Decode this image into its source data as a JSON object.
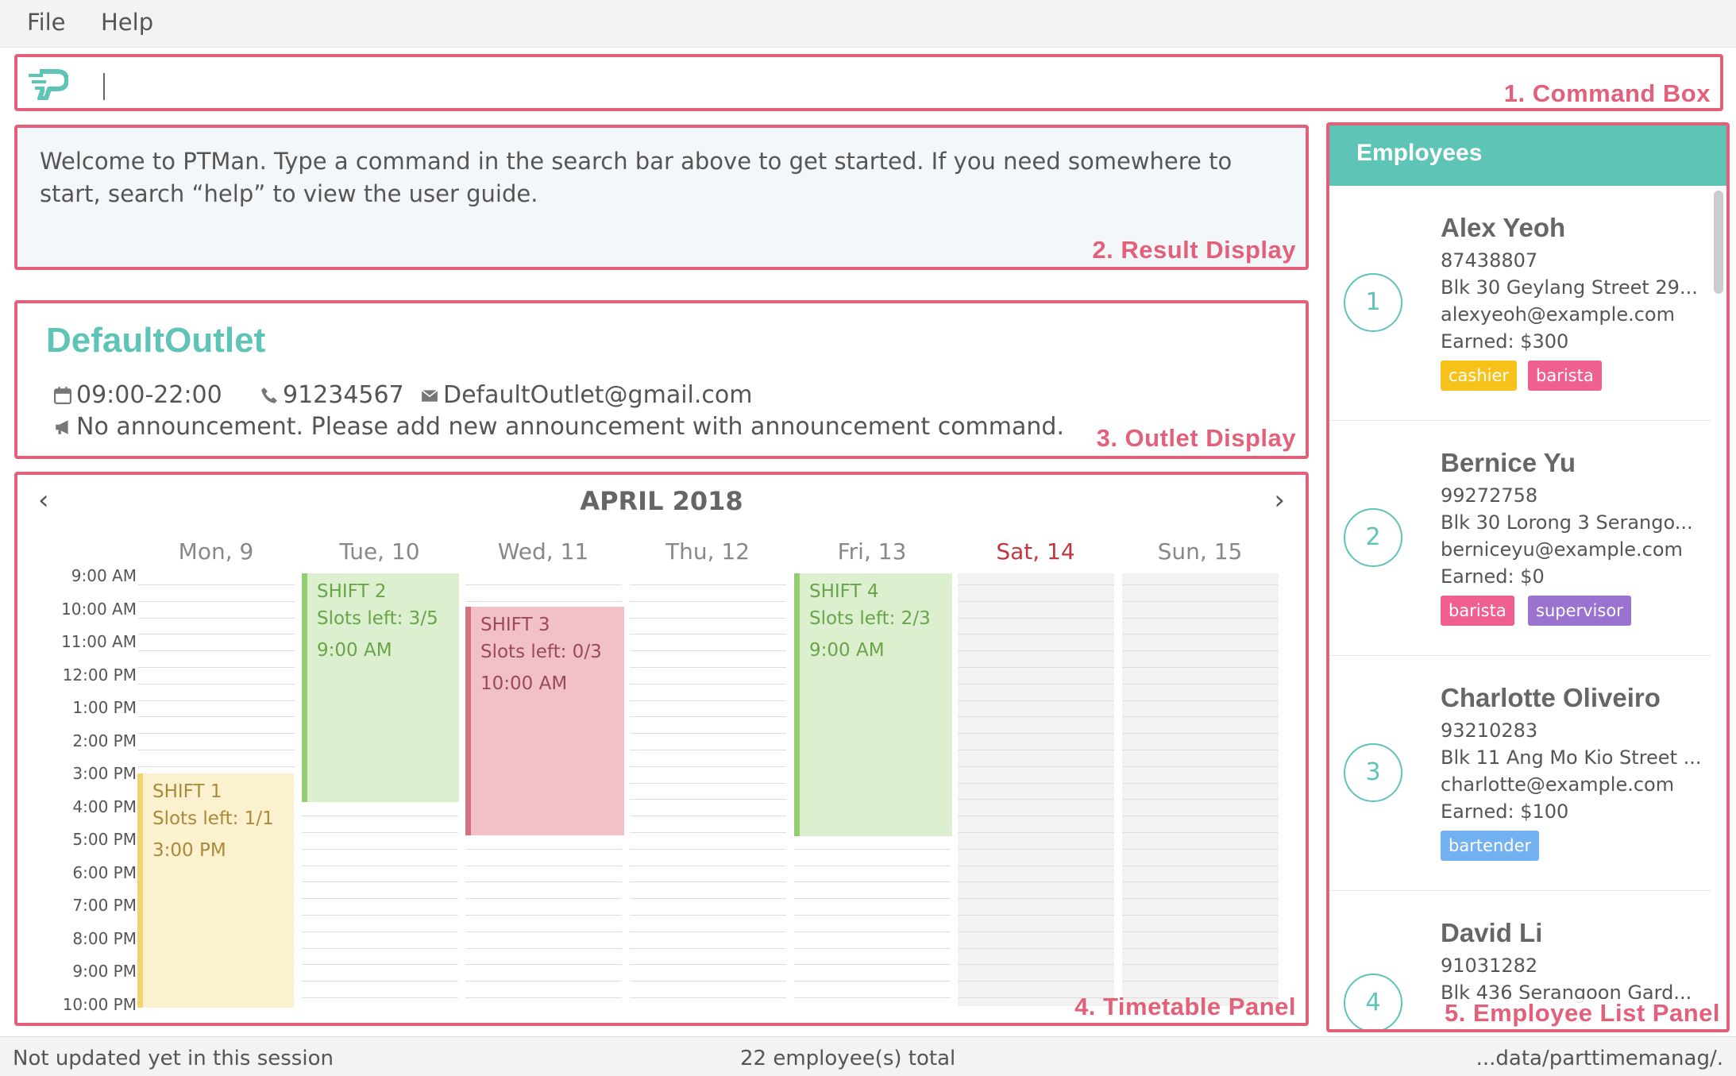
{
  "menu": {
    "file": "File",
    "help": "Help"
  },
  "labels": {
    "command_box": "1. Command Box",
    "result_display": "2. Result Display",
    "outlet_display": "3. Outlet Display",
    "timetable_panel": "4. Timetable Panel",
    "employee_list_panel": "5. Employee List Panel"
  },
  "command": {
    "value": ""
  },
  "result": {
    "text": "Welcome to PTMan. Type a command in the search bar above to get started. If you need somewhere to start, search “help” to view the user guide."
  },
  "outlet": {
    "name": "DefaultOutlet",
    "hours": "09:00-22:00",
    "phone": "91234567",
    "email": "DefaultOutlet@gmail.com",
    "announcement": "No announcement. Please add new announcement with announcement command.",
    "icons": [
      "calendar-icon",
      "phone-icon",
      "envelope-icon",
      "megaphone-icon"
    ]
  },
  "timetable": {
    "month": "APRIL 2018",
    "prev": "‹",
    "next": "›",
    "days": [
      "Mon, 9",
      "Tue, 10",
      "Wed, 11",
      "Thu, 12",
      "Fri, 13",
      "Sat, 14",
      "Sun, 15"
    ],
    "times": [
      "9:00 AM",
      "10:00 AM",
      "11:00 AM",
      "12:00 PM",
      "1:00 PM",
      "2:00 PM",
      "3:00 PM",
      "4:00 PM",
      "5:00 PM",
      "6:00 PM",
      "7:00 PM",
      "8:00 PM",
      "9:00 PM",
      "10:00 PM"
    ],
    "shifts": [
      {
        "title": "SHIFT 1",
        "slots": "Slots left: 1/1",
        "time": "3:00 PM",
        "status": "available"
      },
      {
        "title": "SHIFT 2",
        "slots": "Slots left: 3/5",
        "time": "9:00 AM",
        "status": "open"
      },
      {
        "title": "SHIFT 3",
        "slots": "Slots left: 0/3",
        "time": "10:00 AM",
        "status": "full"
      },
      {
        "title": "SHIFT 4",
        "slots": "Slots left: 2/3",
        "time": "9:00 AM",
        "status": "open"
      }
    ]
  },
  "employees": {
    "header": "Employees",
    "list": [
      {
        "index": "1",
        "name": "Alex Yeoh",
        "phone": "87438807",
        "address": "Blk 30 Geylang Street 29...",
        "email": "alexyeoh@example.com",
        "earned": "Earned: $300",
        "tags": [
          "cashier",
          "barista"
        ]
      },
      {
        "index": "2",
        "name": "Bernice Yu",
        "phone": "99272758",
        "address": "Blk 30 Lorong 3 Serango...",
        "email": "berniceyu@example.com",
        "earned": "Earned: $0",
        "tags": [
          "barista",
          "supervisor"
        ]
      },
      {
        "index": "3",
        "name": "Charlotte Oliveiro",
        "phone": "93210283",
        "address": "Blk 11 Ang Mo Kio Street ...",
        "email": "charlotte@example.com",
        "earned": "Earned: $100",
        "tags": [
          "bartender"
        ]
      },
      {
        "index": "4",
        "name": "David Li",
        "phone": "91031282",
        "address": "Blk 436 Serangoon Gard...",
        "email": "",
        "earned": "",
        "tags": []
      }
    ]
  },
  "colors": {
    "accent": "#5ec4b6",
    "annotation": "#e2607a",
    "tag_cashier": "#f7c21a",
    "tag_barista": "#ef5f8f",
    "tag_supervisor": "#9a72d0",
    "tag_bartender": "#73b2f0",
    "shift_available": "#fbf1cf",
    "shift_open": "#dcf0cf",
    "shift_full": "#f2c1c8"
  },
  "status": {
    "sync": "Not updated yet in this session",
    "total": "22 employee(s) total",
    "path": "...data/parttimemanag/."
  }
}
